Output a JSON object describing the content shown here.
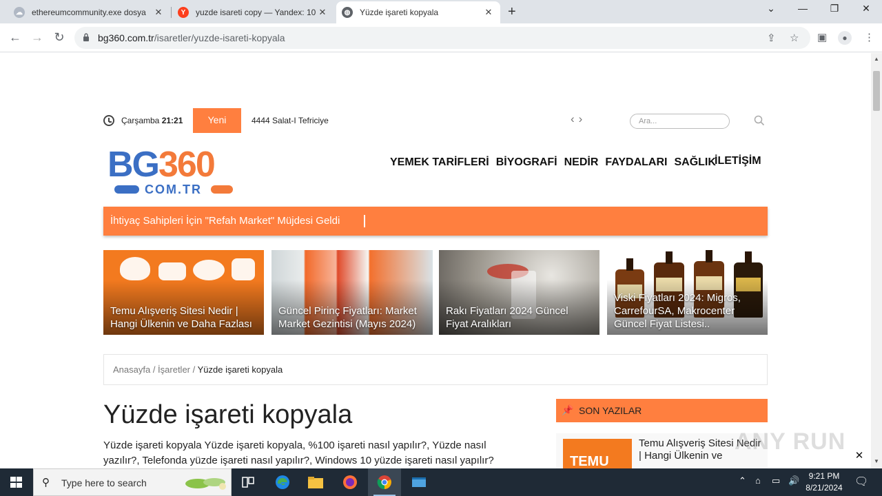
{
  "browser": {
    "tabs": [
      {
        "title": "ethereumcommunity.exe dosya",
        "favicon": "cloud-icon",
        "active": false
      },
      {
        "title": "yuzde isareti copy — Yandex: 10",
        "favicon": "yandex-icon",
        "favicon_letter": "Y",
        "active": false
      },
      {
        "title": "Yüzde işareti kopyala",
        "favicon": "globe-icon",
        "active": true
      }
    ],
    "url_domain": "bg360.com.tr",
    "url_path": "/isaretler/yuzde-isareti-kopyala"
  },
  "page": {
    "topbar": {
      "day": "Çarşamba",
      "time": "21:21",
      "new_label": "Yeni",
      "ticker": "4444 Salat-I Tefriciye",
      "search_placeholder": "Ara..."
    },
    "logo": {
      "main_a": "BG",
      "main_b": "360",
      "sub": "COM.TR"
    },
    "nav": [
      "YEMEK TARİFLERİ",
      "BİYOGRAFİ",
      "NEDİR",
      "FAYDALARI",
      "SAĞLIK"
    ],
    "nav_contact": "İLETİŞİM",
    "banner": "İhtiyaç Sahipleri İçin \"Refah Market\" Müjdesi Geldi",
    "cards": [
      {
        "title": "Temu Alışveriş Sitesi Nedir | Hangi Ülkenin ve Daha Fazlası"
      },
      {
        "title": "Güncel Pirinç Fiyatları: Market Market Gezintisi (Mayıs 2024)"
      },
      {
        "title": "Rakı Fiyatları 2024 Güncel Fiyat Aralıkları"
      },
      {
        "title": "Viski Fiyatları 2024: Migros, CarrefourSA, Makrocenter Güncel Fiyat Listesi.."
      }
    ],
    "breadcrumb": {
      "home": "Anasayfa",
      "sep": " / ",
      "category": "İşaretler",
      "current": "Yüzde işareti kopyala"
    },
    "article": {
      "title": "Yüzde işareti kopyala",
      "intro": "Yüzde işareti kopyala Yüzde işareti kopyala, %100 işareti nasıl yapılır?, Yüzde nasıl yazılır?, Telefonda yüzde işareti nasıl yapılır?, Windows 10 yüzde işareti nasıl yapılır?"
    },
    "sidebar": {
      "heading": "SON YAZILAR",
      "item_thumb_text": "TEMU",
      "item_title": "Temu Alışveriş Sitesi Nedir | Hangi Ülkenin ve"
    },
    "ad_close": "✕",
    "watermark": "ANY RUN"
  },
  "taskbar": {
    "search_placeholder": "Type here to search",
    "time": "9:21 PM",
    "date": "8/21/2024"
  },
  "colors": {
    "accent": "#ff7f3f",
    "logo_blue": "#3b6fc4",
    "taskbar": "#1f2a36"
  }
}
